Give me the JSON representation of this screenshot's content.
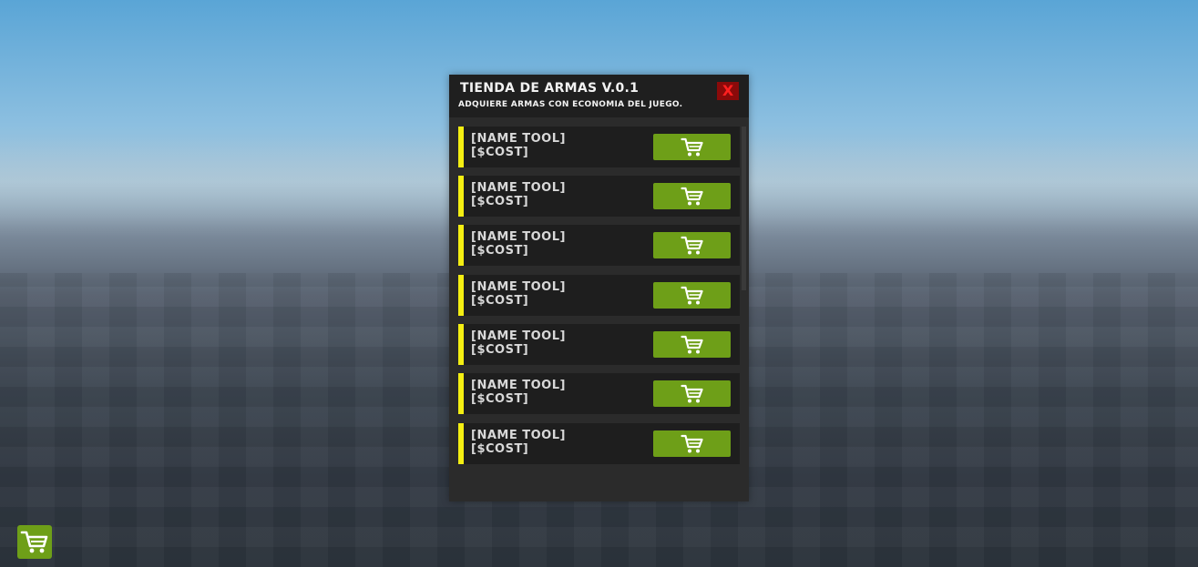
{
  "shop": {
    "title": "TIENDA DE ARMAS V.0.1",
    "subtitle": "ADQUIERE ARMAS CON ECONOMIA DEL JUEGO.",
    "close_label": "X",
    "items": [
      {
        "name": "[NAME TOOL]",
        "cost": "[$COST]",
        "icon": "cart-icon"
      },
      {
        "name": "[NAME TOOL]",
        "cost": "[$COST]",
        "icon": "cart-icon"
      },
      {
        "name": "[NAME TOOL]",
        "cost": "[$COST]",
        "icon": "cart-icon"
      },
      {
        "name": "[NAME TOOL]",
        "cost": "[$COST]",
        "icon": "cart-icon"
      },
      {
        "name": "[NAME TOOL]",
        "cost": "[$COST]",
        "icon": "cart-icon"
      },
      {
        "name": "[NAME TOOL]",
        "cost": "[$COST]",
        "icon": "cart-icon"
      },
      {
        "name": "[NAME TOOL]",
        "cost": "[$COST]",
        "icon": "cart-icon"
      }
    ]
  },
  "hud": {
    "toggle_icon": "cart-icon"
  },
  "colors": {
    "accent_yellow": "#f4ee12",
    "buy_green": "#6e9f18",
    "close_red": "#ff2020",
    "panel_bg": "#2b2b2b",
    "row_bg": "#1e1e1e"
  }
}
